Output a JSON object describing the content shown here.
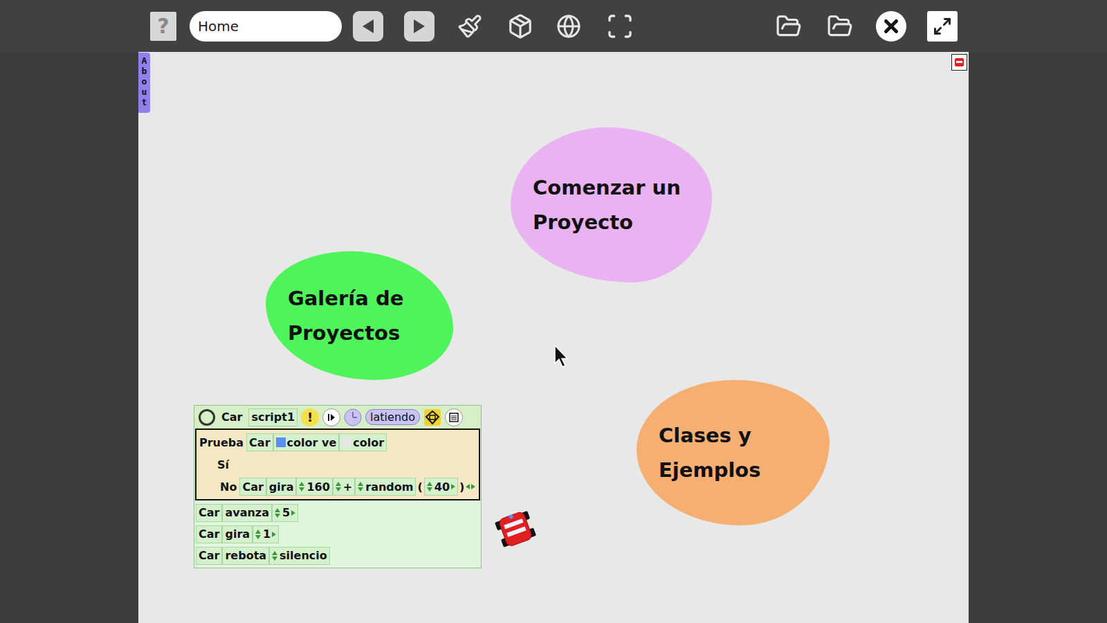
{
  "toolbar": {
    "help_label": "?",
    "project_name": "Home"
  },
  "flap": {
    "label": "About"
  },
  "bubbles": [
    {
      "lines": [
        "Comenzar un",
        "Proyecto"
      ],
      "color": "#e9b3f1"
    },
    {
      "lines": [
        "Galería de",
        "Proyectos"
      ],
      "color": "#4ff35a"
    },
    {
      "lines": [
        "Clases y",
        "Ejemplos"
      ],
      "color": "#f5af72"
    }
  ],
  "script": {
    "object": "Car",
    "name": "script1",
    "warning_glyph": "!",
    "status": "latiendo",
    "test": {
      "keyword": "Prueba",
      "object": "Car",
      "condition": "color ve",
      "condition_color": "#5b8ef0",
      "target": "color",
      "target_color": "#e6e6e6",
      "yes_label": "Sí",
      "no_label": "No",
      "no_action": {
        "object": "Car",
        "verb": "gira",
        "expression": [
          {
            "text": "160",
            "kind": "number"
          },
          {
            "text": "+",
            "kind": "operator"
          },
          {
            "text": "random",
            "kind": "function"
          },
          {
            "text": "(",
            "kind": "paren"
          },
          {
            "text": "40",
            "kind": "argument"
          },
          {
            "text": ")",
            "kind": "paren"
          }
        ]
      }
    },
    "commands": [
      {
        "object": "Car",
        "verb": "avanza",
        "value": "5",
        "kind": "number"
      },
      {
        "object": "Car",
        "verb": "gira",
        "value": "1",
        "kind": "number"
      },
      {
        "object": "Car",
        "verb": "rebota",
        "value": "silencio",
        "kind": "sound"
      }
    ]
  }
}
